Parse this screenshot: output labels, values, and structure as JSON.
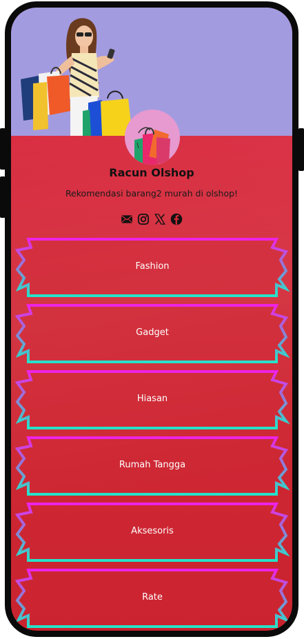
{
  "profile": {
    "name": "Racun Olshop",
    "bio": "Rekomendasi barang2 murah di olshop!"
  },
  "socials": [
    {
      "icon": "email-icon"
    },
    {
      "icon": "instagram-icon"
    },
    {
      "icon": "x-twitter-icon"
    },
    {
      "icon": "facebook-icon"
    }
  ],
  "links": [
    {
      "label": "Fashion"
    },
    {
      "label": "Gadget"
    },
    {
      "label": "Hiasan"
    },
    {
      "label": "Rumah Tangga"
    },
    {
      "label": "Aksesoris"
    },
    {
      "label": "Rate"
    }
  ],
  "colors": {
    "background": "#d12a37",
    "banner": "#a39be0",
    "frame_top": "#ee22e6",
    "frame_bottom": "#24e3c8",
    "text": "#ffffff"
  }
}
